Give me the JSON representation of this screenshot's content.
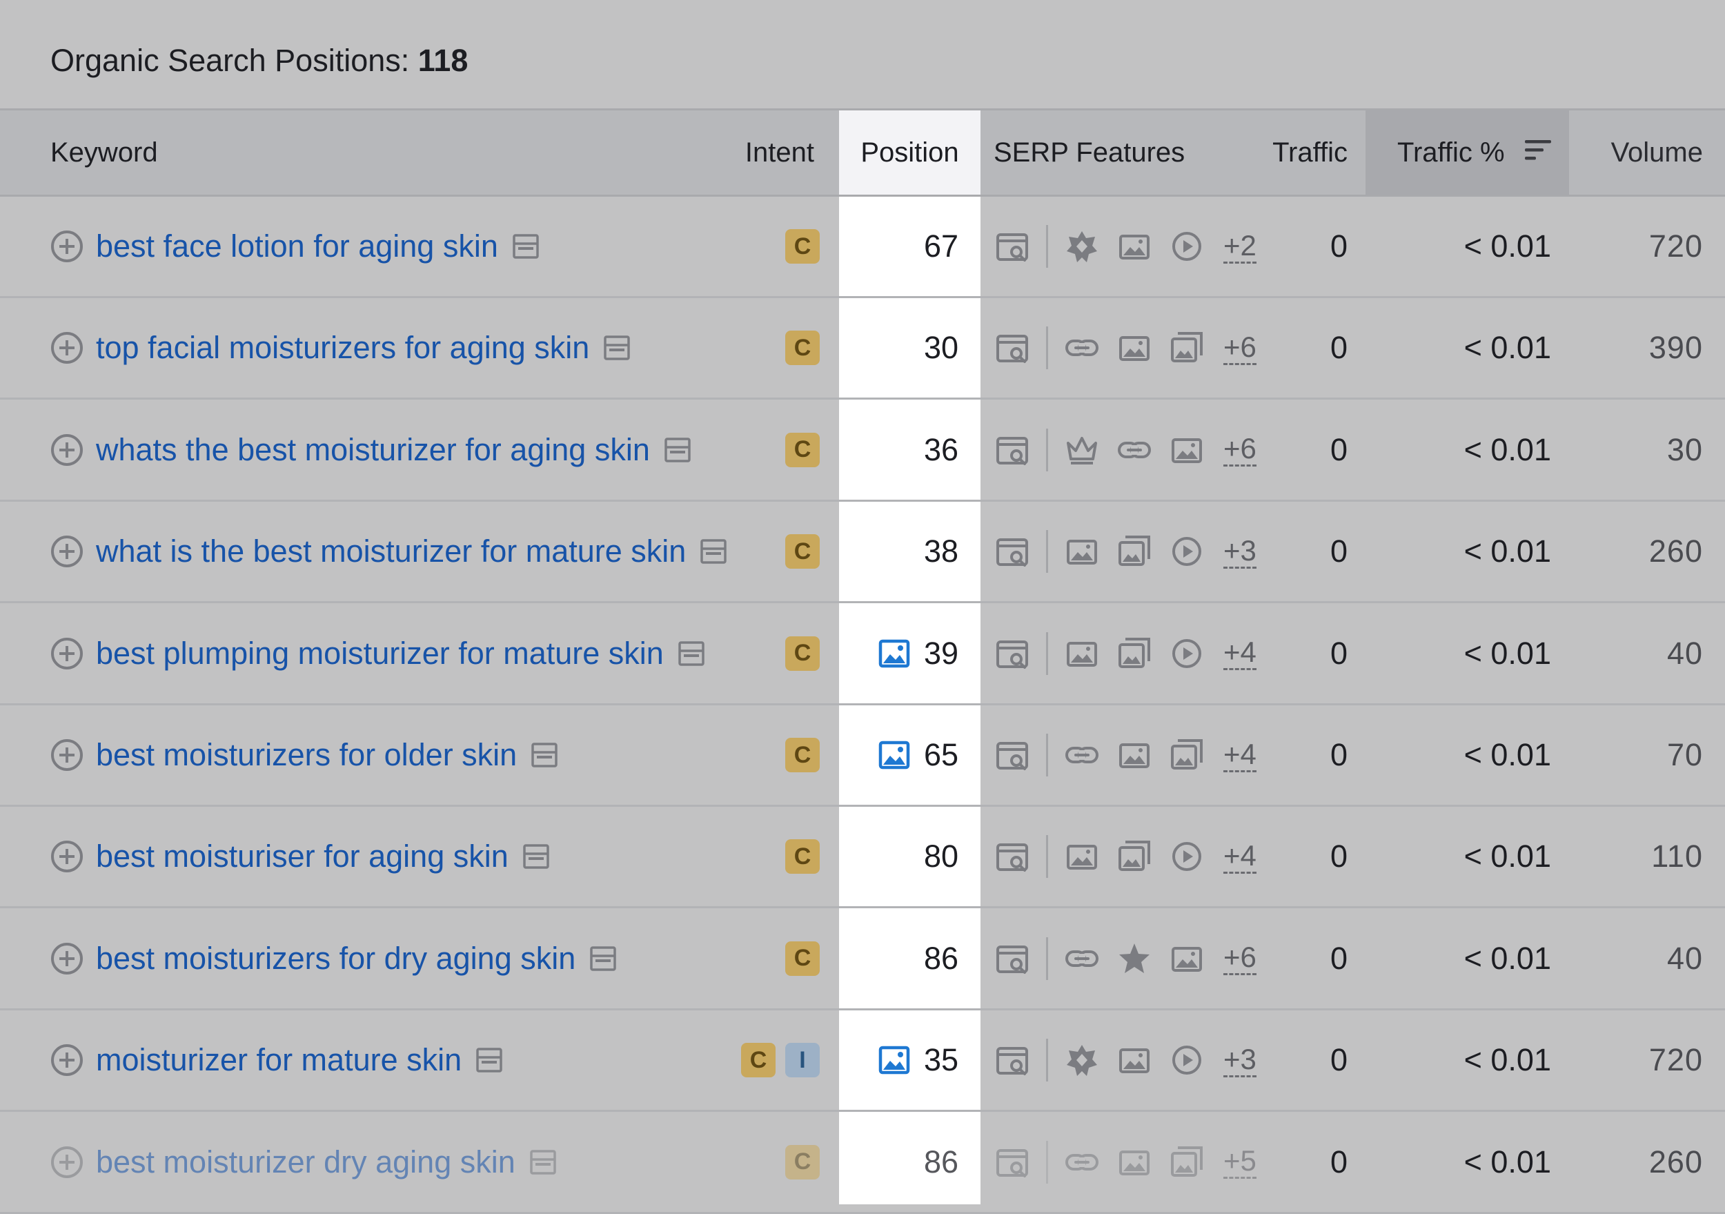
{
  "header": {
    "title_label": "Organic Search Positions:",
    "title_count": "118"
  },
  "columns": {
    "keyword": "Keyword",
    "intent": "Intent",
    "position": "Position",
    "serp_features": "SERP Features",
    "traffic": "Traffic",
    "traffic_pct": "Traffic %",
    "volume": "Volume"
  },
  "rows": [
    {
      "keyword": "best face lotion for aging skin",
      "intents": [
        "C"
      ],
      "position_image": false,
      "position": "67",
      "serp_icons": [
        "magnifier-icon",
        "diamond-badge-icon",
        "image-icon",
        "play-icon"
      ],
      "serp_more": "+2",
      "traffic": "0",
      "traffic_pct": "< 0.01",
      "volume": "720"
    },
    {
      "keyword": "top facial moisturizers for aging skin",
      "intents": [
        "C"
      ],
      "position_image": false,
      "position": "30",
      "serp_icons": [
        "magnifier-icon",
        "link-icon",
        "image-icon",
        "image-stack-icon"
      ],
      "serp_more": "+6",
      "traffic": "0",
      "traffic_pct": "< 0.01",
      "volume": "390"
    },
    {
      "keyword": "whats the best moisturizer for aging skin",
      "intents": [
        "C"
      ],
      "position_image": false,
      "position": "36",
      "serp_icons": [
        "magnifier-icon",
        "crown-icon",
        "link-icon",
        "image-icon"
      ],
      "serp_more": "+6",
      "traffic": "0",
      "traffic_pct": "< 0.01",
      "volume": "30"
    },
    {
      "keyword": "what is the best moisturizer for mature skin",
      "intents": [
        "C"
      ],
      "position_image": false,
      "position": "38",
      "serp_icons": [
        "magnifier-icon",
        "image-icon",
        "image-stack-icon",
        "play-icon"
      ],
      "serp_more": "+3",
      "traffic": "0",
      "traffic_pct": "< 0.01",
      "volume": "260"
    },
    {
      "keyword": "best plumping moisturizer for mature skin",
      "intents": [
        "C"
      ],
      "position_image": true,
      "position": "39",
      "serp_icons": [
        "magnifier-icon",
        "image-icon",
        "image-stack-icon",
        "play-icon"
      ],
      "serp_more": "+4",
      "traffic": "0",
      "traffic_pct": "< 0.01",
      "volume": "40"
    },
    {
      "keyword": "best moisturizers for older skin",
      "intents": [
        "C"
      ],
      "position_image": true,
      "position": "65",
      "serp_icons": [
        "magnifier-icon",
        "link-icon",
        "image-icon",
        "image-stack-icon"
      ],
      "serp_more": "+4",
      "traffic": "0",
      "traffic_pct": "< 0.01",
      "volume": "70"
    },
    {
      "keyword": "best moisturiser for aging skin",
      "intents": [
        "C"
      ],
      "position_image": false,
      "position": "80",
      "serp_icons": [
        "magnifier-icon",
        "image-icon",
        "image-stack-icon",
        "play-icon"
      ],
      "serp_more": "+4",
      "traffic": "0",
      "traffic_pct": "< 0.01",
      "volume": "110"
    },
    {
      "keyword": "best moisturizers for dry aging skin",
      "intents": [
        "C"
      ],
      "position_image": false,
      "position": "86",
      "serp_icons": [
        "magnifier-icon",
        "link-icon",
        "star-icon",
        "image-icon"
      ],
      "serp_more": "+6",
      "traffic": "0",
      "traffic_pct": "< 0.01",
      "volume": "40"
    },
    {
      "keyword": "moisturizer for mature skin",
      "intents": [
        "C",
        "I"
      ],
      "position_image": true,
      "position": "35",
      "serp_icons": [
        "magnifier-icon",
        "diamond-badge-icon",
        "image-icon",
        "play-icon"
      ],
      "serp_more": "+3",
      "traffic": "0",
      "traffic_pct": "< 0.01",
      "volume": "720"
    },
    {
      "keyword": "best moisturizer dry aging skin",
      "intents": [
        "C"
      ],
      "position_image": false,
      "position": "86",
      "serp_icons": [
        "magnifier-icon",
        "link-icon",
        "image-icon",
        "image-stack-icon"
      ],
      "serp_more": "+5",
      "traffic": "0",
      "traffic_pct": "< 0.01",
      "volume": "260"
    }
  ],
  "colors": {
    "keyword_link": "#1753a8",
    "commercial_badge": "#c9a85c",
    "informational_badge": "#9db1c6",
    "position_image_icon": "#1e78d2"
  }
}
